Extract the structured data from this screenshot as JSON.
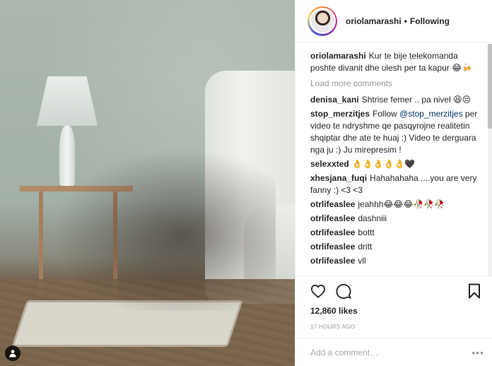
{
  "post": {
    "author": "oriolamarashi",
    "separator": "•",
    "follow_status": "Following",
    "caption": {
      "user": "oriolamarashi",
      "text": "Kur te bije telekomanda poshte divanit dhe ulesh per ta kapur 😂🍻"
    },
    "load_more": "Load more comments",
    "comments": [
      {
        "user": "denisa_kani",
        "text": "Shtrise femer .. pa nivel 😆😒"
      },
      {
        "user": "stop_merzitjes",
        "text_before": "Follow ",
        "mention": "@stop_merzitjes",
        "text_after": " per video te ndryshme qe pasqyrojne realitetin shqiptar dhe ate te huaj :) Video te derguara nga ju :) Ju mirepresim !"
      },
      {
        "user": "selexxted",
        "text": "👌👌👌👌👌🖤"
      },
      {
        "user": "xhesjana_fuqi",
        "text": "Hahahahaha ....you are very fanny :) <3 <3"
      },
      {
        "user": "otrlifeaslee",
        "text": "jeahhh😂😂😂🥀🥀🥀"
      },
      {
        "user": "otrlifeaslee",
        "text": "dashniii"
      },
      {
        "user": "otrlifeaslee",
        "text": "bottt"
      },
      {
        "user": "otrlifeaslee",
        "text": "dritt"
      },
      {
        "user": "otrlifeaslee",
        "text": "vll"
      }
    ],
    "likes": "12,860 likes",
    "timestamp": "17 HOURS AGO",
    "add_comment_placeholder": "Add a comment…",
    "more_options": "•••"
  },
  "icons": {
    "like": "heart-icon",
    "comment": "comment-bubble-icon",
    "save": "bookmark-icon",
    "user_tag": "user-tag-icon"
  },
  "colors": {
    "text": "#262626",
    "muted": "#999999",
    "mention": "#003569",
    "border": "#efefef"
  }
}
